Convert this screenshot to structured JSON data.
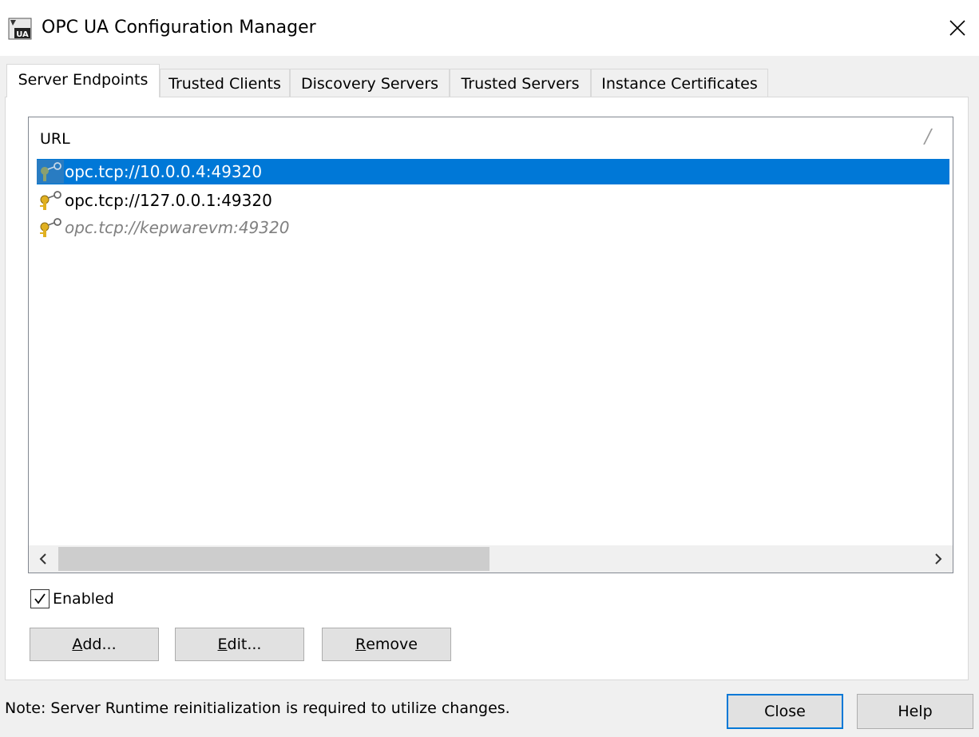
{
  "window": {
    "title": "OPC UA Configuration Manager"
  },
  "tabs": [
    {
      "label": "Server Endpoints",
      "active": true
    },
    {
      "label": "Trusted Clients",
      "active": false
    },
    {
      "label": "Discovery Servers",
      "active": false
    },
    {
      "label": "Trusted Servers",
      "active": false
    },
    {
      "label": "Instance Certificates",
      "active": false
    }
  ],
  "endpoints": {
    "column_header": "URL",
    "rows": [
      {
        "url": "opc.tcp://10.0.0.4:49320",
        "selected": true,
        "enabled": true
      },
      {
        "url": "opc.tcp://127.0.0.1:49320",
        "selected": false,
        "enabled": true
      },
      {
        "url": "opc.tcp://kepwarevm:49320",
        "selected": false,
        "enabled": false
      }
    ]
  },
  "enabled_checkbox": {
    "label": "Enabled",
    "checked": true
  },
  "buttons": {
    "add": {
      "mnemonic": "A",
      "rest": "dd..."
    },
    "edit": {
      "mnemonic": "E",
      "rest": "dit..."
    },
    "remove": {
      "mnemonic": "R",
      "rest": "emove"
    },
    "close": "Close",
    "help": "Help"
  },
  "footer": {
    "note": "Note: Server Runtime reinitialization is required to utilize changes."
  },
  "colors": {
    "selection": "#0078d7",
    "default_button_border": "#0078d7"
  }
}
